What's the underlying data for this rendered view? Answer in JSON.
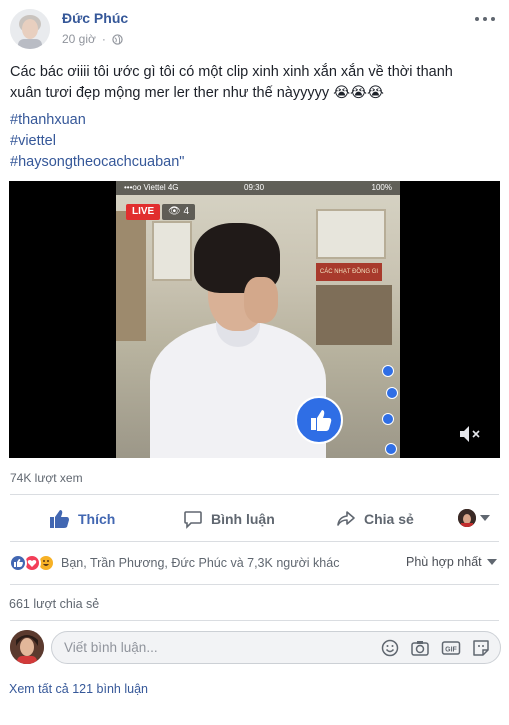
{
  "post": {
    "author": "Đức Phúc",
    "time": "20 giờ",
    "privacy_icon": "globe-icon",
    "text_line1": "Các bác ơiiii tôi ước gì tôi có một clip xinh xinh xắn xắn về thời thanh",
    "text_line2": "xuân tươi đẹp mộng mer ler ther như thế nàyyyyy 😭😭😭",
    "hashtags": [
      "#thanhxuan",
      "#viettel",
      "#haysongtheocachcuaban\""
    ]
  },
  "video": {
    "carrier": "•••oo Viettel  4G",
    "clock": "09:30",
    "battery": "100%",
    "live_label": "LIVE",
    "viewer_count": "4",
    "wall_sign": "CÁC NHẠT ĐỒNG GI"
  },
  "stats": {
    "views": "74K lượt xem",
    "reactions_text": "Bạn, Trần Phương, Đức Phúc và 7,3K người khác",
    "sort_label": "Phù hợp nhất",
    "shares": "661 lượt chia sẻ",
    "view_all_comments": "Xem tất cả 121 bình luận"
  },
  "actions": {
    "like": "Thích",
    "comment": "Bình luận",
    "share": "Chia sẻ"
  },
  "comment": {
    "placeholder": "Viết bình luận..."
  },
  "colors": {
    "link_blue": "#365899",
    "like_blue": "#4267b2",
    "muted_gray": "#606770",
    "divider": "#dadde1"
  }
}
